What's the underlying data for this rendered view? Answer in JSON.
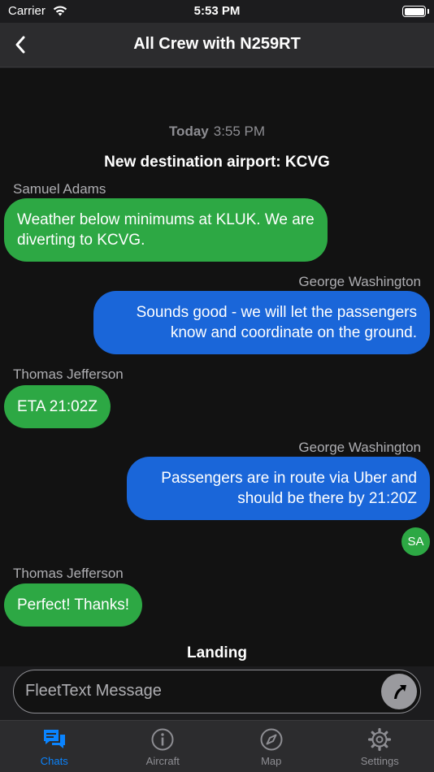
{
  "status_bar": {
    "carrier": "Carrier",
    "time": "5:53 PM"
  },
  "nav": {
    "title": "All Crew with N259RT"
  },
  "chat": {
    "date_day": "Today",
    "date_time": "3:55 PM",
    "system_message": "New destination airport: KCVG",
    "messages": [
      {
        "sender": "Samuel Adams",
        "text": "Weather below minimums at KLUK. We are diverting to KCVG."
      },
      {
        "sender": "George Washington",
        "text": "Sounds good - we will let the passengers know and coordinate on the ground."
      },
      {
        "sender": "Thomas Jefferson",
        "text": "ETA 21:02Z"
      },
      {
        "sender": "George Washington",
        "text": "Passengers are in route via Uber and should be there by 21:20Z"
      },
      {
        "sender": "Thomas Jefferson",
        "text": "Perfect! Thanks!"
      }
    ],
    "read_receipt_initials": "SA",
    "footer_status": "Landing"
  },
  "composer": {
    "placeholder": "FleetText Message"
  },
  "tabs": [
    {
      "label": "Chats",
      "icon": "chat-bubbles-icon",
      "active": true
    },
    {
      "label": "Aircraft",
      "icon": "info-circle-icon",
      "active": false
    },
    {
      "label": "Map",
      "icon": "compass-icon",
      "active": false
    },
    {
      "label": "Settings",
      "icon": "gear-icon",
      "active": false
    }
  ],
  "colors": {
    "incoming_bubble": "#2da844",
    "outgoing_bubble": "#1a66d9",
    "accent": "#0a84ff"
  }
}
